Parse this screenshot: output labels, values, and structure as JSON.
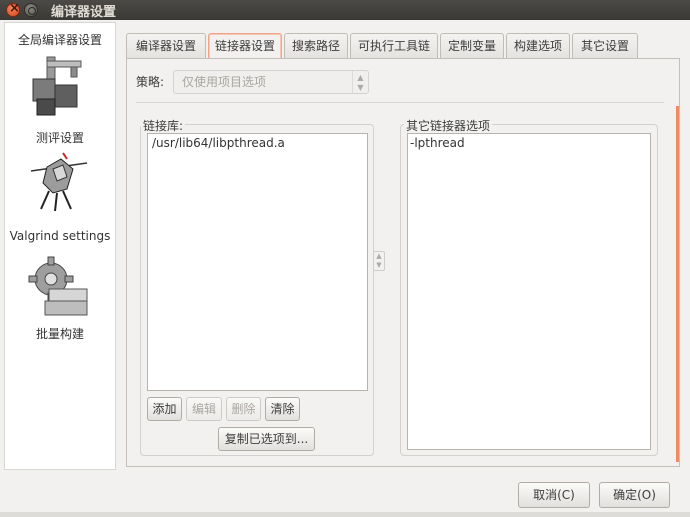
{
  "window": {
    "title": "编译器设置"
  },
  "sidebar": {
    "header": "全局编译器设置",
    "items": [
      {
        "label": "测评设置",
        "icon": "caliper-blocks-icon"
      },
      {
        "label": "Valgrind settings",
        "icon": "valgrind-knight-icon"
      },
      {
        "label": "批量构建",
        "icon": "gear-blocks-icon"
      }
    ]
  },
  "tabs": [
    "编译器设置",
    "链接器设置",
    "搜索路径",
    "可执行工具链",
    "定制变量",
    "构建选项",
    "其它设置"
  ],
  "active_tab": "链接器设置",
  "policy": {
    "label": "策略:",
    "value": "仅使用项目选项"
  },
  "link_libraries": {
    "label": "链接库:",
    "items": [
      "/usr/lib64/libpthread.a"
    ],
    "buttons": {
      "add": "添加",
      "edit": "编辑",
      "delete": "删除",
      "clear": "清除"
    },
    "copy_button": "复制已选项到..."
  },
  "other_linker_options": {
    "label": "其它链接器选项",
    "text": "-lpthread"
  },
  "dialog_buttons": {
    "cancel": "取消(C)",
    "ok": "确定(O)"
  },
  "colors": {
    "accent": "#f08a60",
    "titlebar": "#3c3b37",
    "close": "#e0562b"
  }
}
